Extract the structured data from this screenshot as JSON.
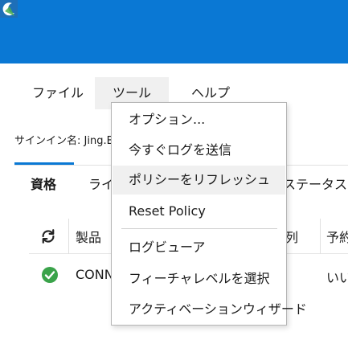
{
  "menubar": {
    "file": "ファイル",
    "tools": "ツール",
    "help": "ヘルプ"
  },
  "signin": {
    "text": "サインイン名: Jing.B"
  },
  "tabs": [
    {
      "label": "資格"
    },
    {
      "label": "ライ"
    },
    {
      "label": "ステータス"
    }
  ],
  "table": {
    "headers": [
      "製品",
      "列",
      "予約"
    ],
    "rows": [
      {
        "product": "CONN",
        "reserve": "いい"
      }
    ]
  },
  "tools_menu": {
    "items": [
      "オプション...",
      "今すぐログを送信",
      "ポリシーをリフレッシュ",
      "Reset Policy",
      "ログビューア",
      "フィーチャレベルを選択",
      "アクティベーションウィザード"
    ]
  },
  "colors": {
    "titlebar": "#0a78d4",
    "accent": "#0a78d4",
    "status_ok": "#3aa34a"
  },
  "icons": {
    "app": "app-logo-icon",
    "refresh": "refresh-icon",
    "status": "check-circle-icon"
  }
}
